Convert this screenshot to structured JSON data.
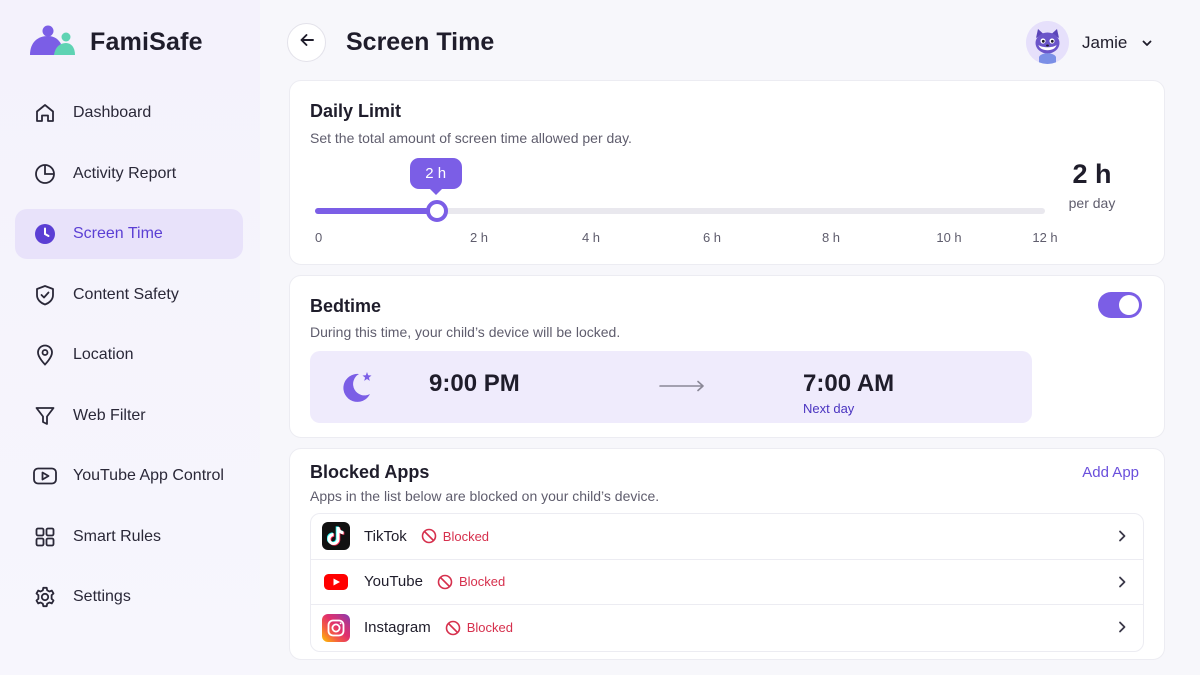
{
  "brand": {
    "name": "FamiSafe"
  },
  "sidebar": {
    "items": [
      {
        "label": "Dashboard",
        "icon": "home-icon"
      },
      {
        "label": "Activity Report",
        "icon": "pie-chart-icon"
      },
      {
        "label": "Screen Time",
        "icon": "clock-icon",
        "active": true
      },
      {
        "label": "Content Safety",
        "icon": "shield-check-icon"
      },
      {
        "label": "Location",
        "icon": "location-pin-icon"
      },
      {
        "label": "Web Filter",
        "icon": "filter-icon"
      },
      {
        "label": "YouTube App Control",
        "icon": "youtube-icon"
      },
      {
        "label": "Smart Rules",
        "icon": "grid-icon"
      },
      {
        "label": "Settings",
        "icon": "gear-icon"
      }
    ]
  },
  "header": {
    "title": "Screen Time",
    "user": {
      "name": "Jamie"
    }
  },
  "daily_limit": {
    "title": "Daily Limit",
    "subtitle": "Set the total amount of screen time allowed per day.",
    "slider": {
      "min": 0,
      "max": 12,
      "value": 2,
      "tooltip": "2 h",
      "ticks": [
        "0",
        "2 h",
        "4 h",
        "6 h",
        "8 h",
        "10 h",
        "12 h"
      ]
    },
    "value_label": "2 h",
    "value_unit": "per day"
  },
  "bedtime": {
    "title": "Bedtime",
    "subtitle": "During this time, your child’s device will be locked.",
    "enabled": true,
    "start": "9:00 PM",
    "end": "7:00 AM",
    "end_note": "Next day"
  },
  "blocked_apps": {
    "title": "Blocked Apps",
    "subtitle": "Apps in the list below are blocked on your child’s device.",
    "add_label": "Add App",
    "apps": [
      {
        "name": "TikTok",
        "status": "Blocked",
        "icon": "tiktok-icon"
      },
      {
        "name": "YouTube",
        "status": "Blocked",
        "icon": "youtube-logo-icon"
      },
      {
        "name": "Instagram",
        "status": "Blocked",
        "icon": "instagram-icon"
      }
    ]
  },
  "colors": {
    "accent": "#7b5ee6",
    "accent_bg": "#e8e2fa",
    "blocked_red": "#d6304d"
  }
}
